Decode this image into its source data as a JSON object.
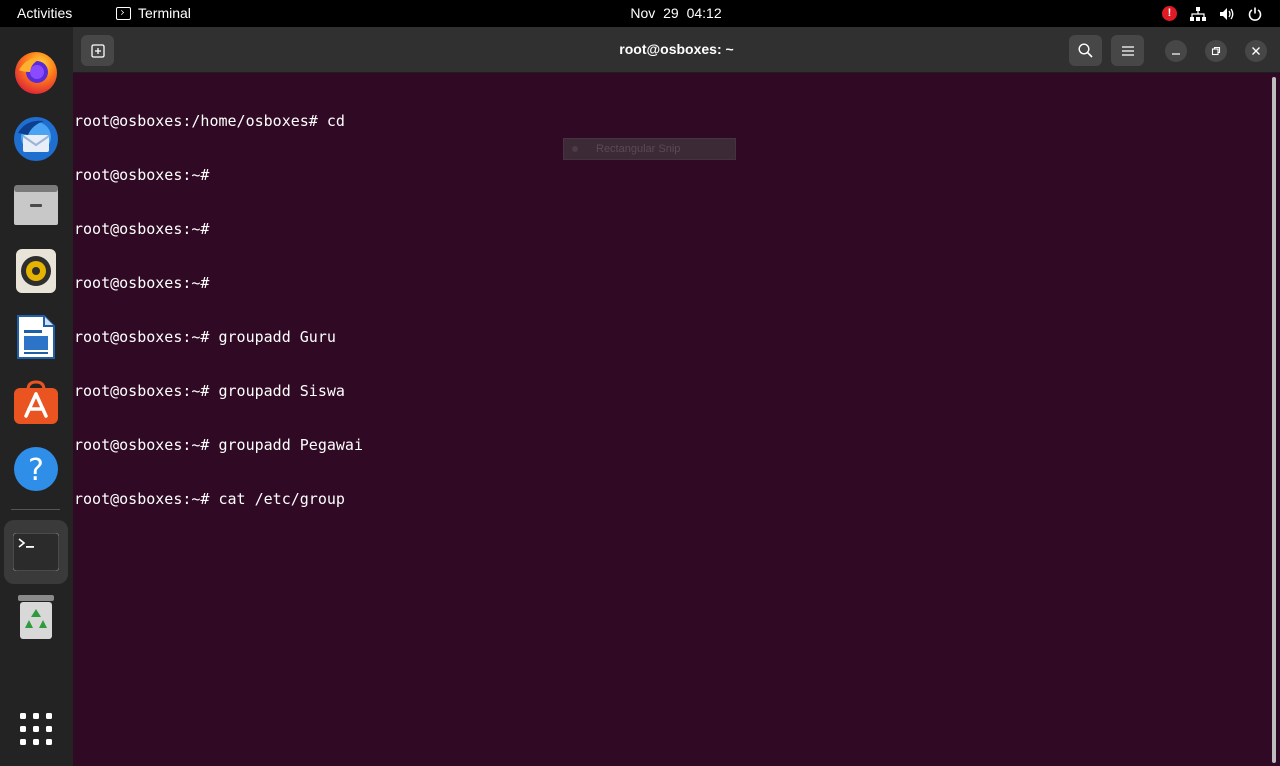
{
  "topbar": {
    "activities": "Activities",
    "app_name": "Terminal",
    "datetime": "Nov 29  04:12"
  },
  "window": {
    "title": "root@osboxes: ~"
  },
  "terminal": {
    "lines": [
      "root@osboxes:/home/osboxes# cd",
      "root@osboxes:~#",
      "root@osboxes:~#",
      "root@osboxes:~#",
      "root@osboxes:~# groupadd Guru",
      "root@osboxes:~# groupadd Siswa",
      "root@osboxes:~# groupadd Pegawai",
      "root@osboxes:~# cat /etc/group"
    ]
  },
  "overlay": {
    "snip_label": "Rectangular Snip"
  },
  "dock": {
    "items": [
      "firefox-icon",
      "thunderbird-icon",
      "files-icon",
      "rhythmbox-icon",
      "libreoffice-writer-icon",
      "app-center-icon",
      "help-icon",
      "terminal-icon",
      "trash-icon",
      "show-apps-icon"
    ]
  },
  "colors": {
    "terminal_bg": "#300a24",
    "accent": "#e95420",
    "alert": "#e01b24"
  }
}
